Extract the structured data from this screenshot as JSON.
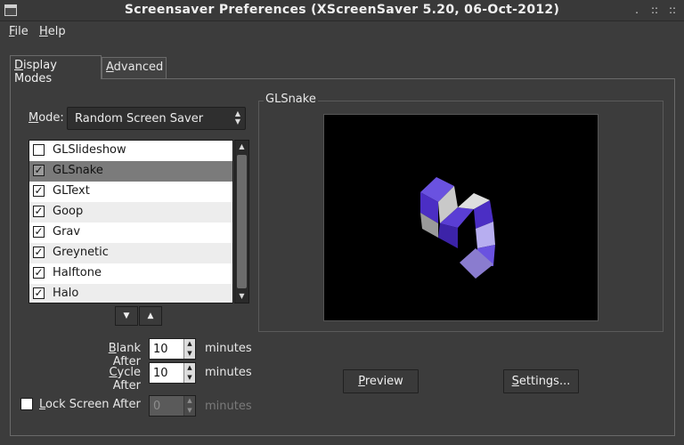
{
  "window": {
    "title": "Screensaver Preferences  (XScreenSaver 5.20, 06-Oct-2012)",
    "controls": [
      ".",
      "::",
      "::"
    ]
  },
  "menu": {
    "file_first": "F",
    "file_rest": "ile",
    "help_first": "H",
    "help_rest": "elp"
  },
  "tabs": {
    "display_first": "D",
    "display_rest": "isplay Modes",
    "advanced_first": "A",
    "advanced_rest": "dvanced"
  },
  "mode": {
    "label_first": "M",
    "label_rest": "ode:",
    "selected": "Random Screen Saver"
  },
  "hack_list": [
    {
      "name": "GLSlideshow",
      "checked": false,
      "selected": false
    },
    {
      "name": "GLSnake",
      "checked": true,
      "selected": true
    },
    {
      "name": "GLText",
      "checked": true,
      "selected": false
    },
    {
      "name": "Goop",
      "checked": true,
      "selected": false
    },
    {
      "name": "Grav",
      "checked": true,
      "selected": false
    },
    {
      "name": "Greynetic",
      "checked": true,
      "selected": false
    },
    {
      "name": "Halftone",
      "checked": true,
      "selected": false
    },
    {
      "name": "Halo",
      "checked": true,
      "selected": false
    }
  ],
  "move_buttons": {
    "down": "▼",
    "up": "▲"
  },
  "blank": {
    "label_first": "B",
    "label_rest": "lank After",
    "value": "10",
    "unit": "minutes"
  },
  "cycle": {
    "label_first": "C",
    "label_rest": "ycle After",
    "value": "10",
    "unit": "minutes"
  },
  "lock": {
    "label_first": "L",
    "label_rest": "ock Screen After",
    "value": "0",
    "unit": "minutes",
    "checked": false
  },
  "preview_frame": {
    "title": "GLSnake"
  },
  "buttons": {
    "preview_first": "P",
    "preview_rest": "review",
    "settings_first": "S",
    "settings_rest": "ettings..."
  },
  "glyphs": {
    "check": "✓",
    "spin_up": "▲",
    "spin_down": "▼",
    "select_up": "▲",
    "select_down": "▼"
  },
  "colors": {
    "snake_dark": "#4b2ec4",
    "snake_light": "#b7aef0",
    "snake_grey": "#c9c9c9"
  }
}
